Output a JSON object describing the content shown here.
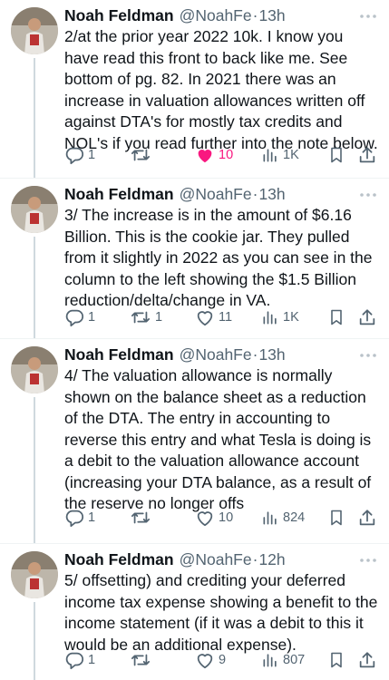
{
  "tweets": [
    {
      "name": "Noah Feldman",
      "handle": "@NoahFe",
      "sep": "·",
      "time": "13h",
      "text": "2/at the prior year 2022 10k. I know you have read this front to back like me. See bottom of pg. 82. In 2021 there was an increase in valuation allowances written off against DTA's for mostly tax credits and NOL's if you read further into the note below.",
      "replies": "1",
      "retweets": "",
      "likes": "10",
      "liked": true,
      "views": "1K"
    },
    {
      "name": "Noah Feldman",
      "handle": "@NoahFe",
      "sep": "·",
      "time": "13h",
      "text": "3/ The increase is in the amount of $6.16 Billion. This is the cookie jar. They pulled from it slightly in 2022 as you can see in the column to the left showing the $1.5 Billion reduction/delta/change in VA.",
      "replies": "1",
      "retweets": "1",
      "likes": "11",
      "liked": false,
      "views": "1K"
    },
    {
      "name": "Noah Feldman",
      "handle": "@NoahFe",
      "sep": "·",
      "time": "13h",
      "text": "4/ The valuation allowance is normally shown on the balance sheet as a reduction of the DTA. The entry in accounting to reverse this entry and what Tesla is doing is a debit to the valuation allowance account (increasing your DTA balance, as a result of the reserve no longer offs",
      "replies": "1",
      "retweets": "",
      "likes": "10",
      "liked": false,
      "views": "824"
    },
    {
      "name": "Noah Feldman",
      "handle": "@NoahFe",
      "sep": "·",
      "time": "12h",
      "text": "5/ offsetting) and crediting your deferred income tax expense showing a benefit to the income statement (if it was a debit to this it would be an additional expense).",
      "replies": "1",
      "retweets": "",
      "likes": "9",
      "liked": false,
      "views": "807"
    }
  ],
  "colors": {
    "text": "#0f1419",
    "secondary": "#536471",
    "like_active": "#f91880",
    "divider": "#eff3f4",
    "thread_line": "#cfd9de"
  },
  "icons": [
    "more-icon",
    "reply-icon",
    "retweet-icon",
    "like-icon",
    "views-icon",
    "bookmark-icon",
    "share-icon"
  ]
}
